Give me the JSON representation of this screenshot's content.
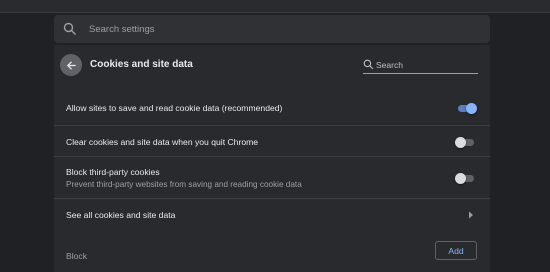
{
  "search": {
    "placeholder": "Search settings"
  },
  "header": {
    "title": "Cookies and site data",
    "search_placeholder": "Search"
  },
  "settings": [
    {
      "label": "Allow sites to save and read cookie data (recommended)",
      "toggle": true
    },
    {
      "label": "Clear cookies and site data when you quit Chrome",
      "toggle": false
    },
    {
      "label": "Block third-party cookies",
      "sublabel": "Prevent third-party websites from saving and reading cookie data",
      "toggle": false
    }
  ],
  "see_all": {
    "label": "See all cookies and site data"
  },
  "block": {
    "label": "Block",
    "add_label": "Add"
  },
  "colors": {
    "accent": "#8ab4f8",
    "background": "#202124",
    "panel": "#292a2d"
  },
  "icons": [
    "search-icon",
    "back-arrow-icon",
    "chevron-right-icon"
  ]
}
